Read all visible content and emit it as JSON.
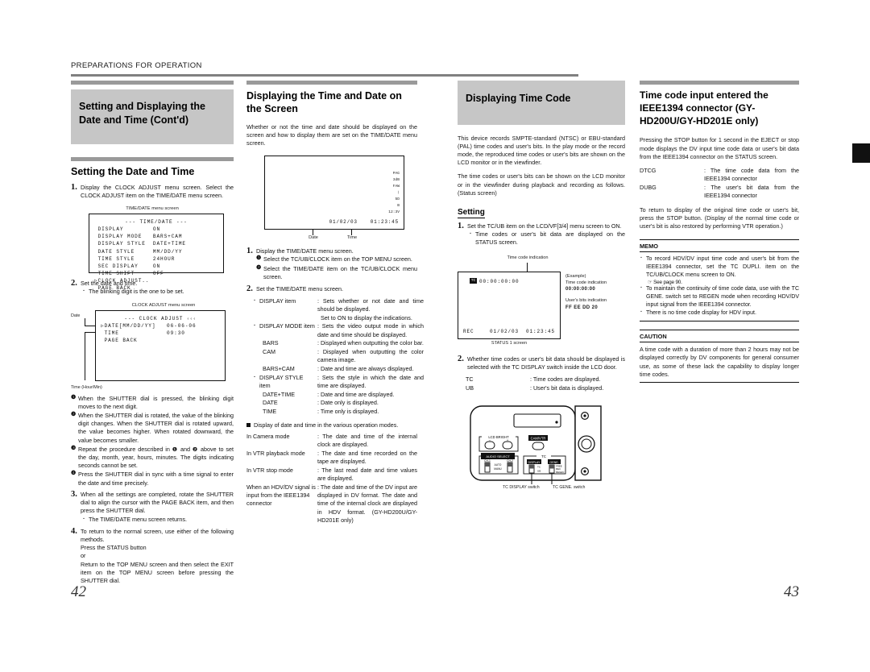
{
  "running_head": "PREPARATIONS FOR OPERATION",
  "page_numbers": {
    "left": "42",
    "right": "43"
  },
  "col1": {
    "heading": "Setting and Displaying the Date and Time (Cont'd)",
    "subheading": "Setting the Date and Time",
    "step1_num": "1.",
    "step1_text": "Display the CLOCK ADJUST menu screen. Select the CLOCK ADJUST item on the TIME/DATE menu screen.",
    "timedate_caption": "TIME/DATE menu screen",
    "timedate_menu": {
      "title": "--- TIME/DATE ---",
      "rows": [
        {
          "label": "DISPLAY",
          "value": "ON",
          "cursor": false
        },
        {
          "label": "DISPLAY MODE",
          "value": "BARS+CAM",
          "cursor": false
        },
        {
          "label": "DISPLAY STYLE",
          "value": "DATE+TIME",
          "cursor": false
        },
        {
          "label": "DATE STYLE",
          "value": "MM/DD/YY",
          "cursor": false
        },
        {
          "label": "TIME STYLE",
          "value": "24HOUR",
          "cursor": false
        },
        {
          "label": "SEC DISPLAY",
          "value": "ON",
          "cursor": false
        },
        {
          "label": "TIME SHIFT",
          "value": "OFF",
          "cursor": false
        },
        {
          "label": "CLOCK ADJUST..",
          "value": "",
          "cursor": true
        },
        {
          "label": "PAGE BACK",
          "value": "",
          "cursor": false
        }
      ]
    },
    "step2_num": "2.",
    "step2_text": "Set the date and time.",
    "step2_bullet": "The blinking digit is the one to be set.",
    "clock_caption": "CLOCK ADJUST menu screen",
    "label_date": "Date",
    "label_time": "Time (Hour/Min)",
    "clock_menu": {
      "title": "--- CLOCK ADJUST",
      "title_arrows": "‹‹‹",
      "rows": [
        {
          "label": "DATE[MM/DD/YY]",
          "value": "06-06-06",
          "cursor": true
        },
        {
          "label": "TIME",
          "value": "09:30",
          "cursor": false
        },
        {
          "label": "PAGE BACK",
          "value": "",
          "cursor": false
        }
      ]
    },
    "substeps": [
      {
        "n": "❶",
        "t": "When the SHUTTER dial is pressed, the blinking digit moves to the next digit."
      },
      {
        "n": "❷",
        "t": "When the SHUTTER dial is rotated, the value of the blinking digit changes. When the SHUTTER dial is rotated upward, the value becomes higher. When rotated downward, the value becomes smaller."
      },
      {
        "n": "❸",
        "t": "Repeat the procedure described in ❶ and ❷ above to set the day, month, year, hours, minutes. The digits indicating seconds cannot be set."
      },
      {
        "n": "❹",
        "t": "Press the SHUTTER dial in sync with a time signal to enter the date and time precisely."
      }
    ],
    "step3_num": "3.",
    "step3_text": "When all the settings are completed, rotate the SHUTTER dial to align the cursor with the PAGE BACK item, and then press the SHUTTER dial.",
    "step3_bullet": "The TIME/DATE menu screen returns.",
    "step4_num": "4.",
    "step4_text": "To return to the normal screen, use either of the following methods.",
    "step4_lines": [
      "Press the STATUS button",
      "or",
      "Return to the TOP MENU screen and then select the EXIT item on the TOP MENU screen before pressing the SHUTTER dial."
    ]
  },
  "col2": {
    "heading": "Displaying the Time and Date on the Screen",
    "intro": "Whether or not the time and date should be displayed on the screen and how to display them are set on the TIME/DATE menu screen.",
    "viewfinder": {
      "side_indicators": [
        "PAG",
        "3dB",
        "FAW",
        "❘",
        "5D",
        "B",
        "12:3V"
      ],
      "date": "01/02/03",
      "time": "01:23:45",
      "label_date": "Date",
      "label_time": "Time"
    },
    "step1_num": "1.",
    "step1_text": "Display the TIME/DATE menu screen.",
    "step1_subs": [
      {
        "n": "❶",
        "t": "Select the TC/UB/CLOCK item on the TOP MENU screen."
      },
      {
        "n": "❷",
        "t": "Select the TIME/DATE item on the TC/UB/CLOCK menu screen."
      }
    ],
    "step2_num": "2.",
    "step2_text": "Set the TIME/DATE menu screen.",
    "items": [
      {
        "lbl": "DISPLAY item",
        "dsc": "Sets whether or not date and time should be displayed.\nSet to ON to display the indications.",
        "bullet": true,
        "indent": 0
      },
      {
        "lbl": "DISPLAY MODE item",
        "dsc": "Sets the video output mode in which date and time should be displayed.",
        "bullet": true,
        "indent": 0
      },
      {
        "lbl": "BARS",
        "dsc": "Displayed when outputting the color bar.",
        "bullet": false,
        "indent": 1
      },
      {
        "lbl": "CAM",
        "dsc": "Displayed when outputting the color camera image.",
        "bullet": false,
        "indent": 1
      },
      {
        "lbl": "BARS+CAM",
        "dsc": "Date and time are always displayed.",
        "bullet": false,
        "indent": 1
      },
      {
        "lbl": "DISPLAY STYLE item",
        "dsc": "Sets the style in which the date and time are displayed.",
        "bullet": true,
        "indent": 0
      },
      {
        "lbl": "DATE+TIME",
        "dsc": "Date and time are displayed.",
        "bullet": false,
        "indent": 1
      },
      {
        "lbl": "DATE",
        "dsc": "Date only is displayed.",
        "bullet": false,
        "indent": 1
      },
      {
        "lbl": "TIME",
        "dsc": "Time only is displayed.",
        "bullet": false,
        "indent": 1
      }
    ],
    "modes_heading": "Display of date and time in the various operation modes.",
    "modes": [
      {
        "lbl": "In Camera mode",
        "dsc": "The date and time of the internal clock are displayed."
      },
      {
        "lbl": "In VTR playback mode",
        "dsc": "The date and time recorded on the tape are displayed."
      },
      {
        "lbl": "In VTR stop mode",
        "dsc": "The last read date and time values are displayed."
      },
      {
        "lbl": "When an HDV/DV signal is input from the IEEE1394 connector",
        "dsc": "The date and time of the DV input are displayed in DV format. The date and time of the internal clock are displayed in HDV format. (GY-HD200U/GY-HD201E only)"
      }
    ]
  },
  "col3": {
    "heading": "Displaying Time Code",
    "para1": "This device records SMPTE-standard (NTSC) or EBU-standard (PAL) time codes and user's bits. In the play mode or the record mode, the reproduced time codes or user's bits are shown on the LCD monitor or in the viewfinder.",
    "para2": "The time codes or user's bits can be shown on the LCD monitor or in the viewfinder during playback and recording as follows. (Status screen)",
    "setting_heading": "Setting",
    "step1_num": "1.",
    "step1_text": "Set the TC/UB item on the LCD/VF[3/4] menu screen to ON.",
    "step1_bullet": "Time codes or user's bit data are displayed on the STATUS screen.",
    "status_screen": {
      "callout": "Time code indication",
      "tc_icon": "TC",
      "tc_value": "00:00:00:00",
      "rec_label": "REC",
      "date": "01/02/03",
      "time": "01:23:45",
      "caption": "STATUS 1 screen",
      "example_label": "(Example)",
      "tc_ind_label": "Time code indication",
      "tc_ind_value": "00:00:00:00",
      "ub_ind_label": "User's bits indication",
      "ub_ind_value": "FF EE DD 20"
    },
    "step2_num": "2.",
    "step2_text": "Whether time codes or user's bit data should be displayed is selected with the TC DISPLAY switch inside the LCD door.",
    "step2_items": [
      {
        "lbl": "TC",
        "dsc": "Time codes are displayed."
      },
      {
        "lbl": "UB",
        "dsc": "User's bit data is displayed."
      }
    ],
    "panel": {
      "lcd_bright": "LCD BRIGHT",
      "lcd_minus": "−",
      "lcd_plus": "+",
      "cam_vtr": "CAM/VTR",
      "audio_select": "AUDIO SELECT",
      "ch1": "CH-1",
      "ch2": "CH-2",
      "auto": "AUTO",
      "manu": "MANU",
      "tc": "TC",
      "display": "DISPLAY",
      "gene": "GENE.",
      "sw_tc": "TC",
      "sw_ub": "UB",
      "sw_free": "FREE",
      "sw_rec": "REC",
      "sw_regen": "REGEN",
      "caption_left": "TC DISPLAY switch",
      "caption_right": "TC GENE. switch"
    }
  },
  "col4": {
    "heading": "Time code input entered the IEEE1394 connector (GY-HD200U/GY-HD201E only)",
    "para1": "Pressing the STOP button for 1 second in the EJECT or stop mode displays the DV input time code data or user's bit data from the IEEE1394 connector on the STATUS screen.",
    "defs": [
      {
        "lbl": "DTCG",
        "dsc": "The time code data from the IEEE1394 connector"
      },
      {
        "lbl": "DUBG",
        "dsc": "The user's bit data from the IEEE1394 connector"
      }
    ],
    "para2": "To return to display of the original time code or user's bit, press the STOP button. (Display of the normal time code or user's bit is also restored by performing VTR operation.)",
    "memo_title": "MEMO",
    "memo_items": [
      "To record HDV/DV input time code and user's bit from the IEEE1394 connector, set the TC DUPLI. item on the TC/UB/CLOCK menu screen to ON.",
      "To maintain the continuity of time code data, use with the TC GENE. switch set to REGEN mode when recording HDV/DV input signal from the IEEE1394 connector.",
      "There is no time code display for HDV input."
    ],
    "memo_see": "☞ See page 90.",
    "caution_title": "CAUTION",
    "caution_text": "A time code with a duration of more than 2 hours may not be displayed correctly by DV components for general consumer use, as some of these lack the capability to display longer time codes."
  }
}
